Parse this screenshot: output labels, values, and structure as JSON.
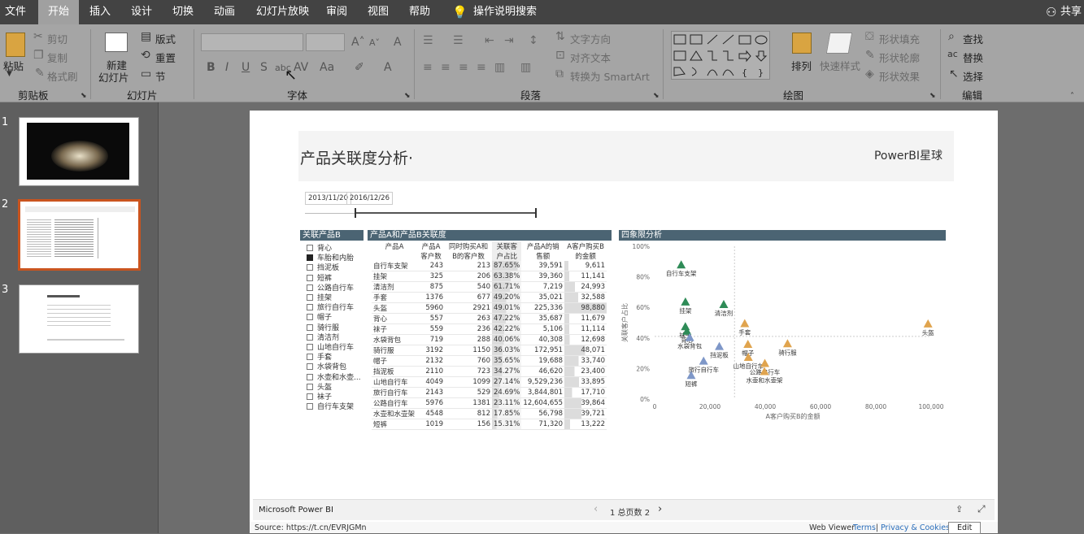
{
  "tabs": [
    "文件",
    "开始",
    "插入",
    "设计",
    "切换",
    "动画",
    "幻灯片放映",
    "审阅",
    "视图",
    "帮助",
    "操作说明搜索"
  ],
  "share_label": "共享",
  "ribbon": {
    "clipboard": {
      "paste": "粘贴",
      "cut": "剪切",
      "copy": "复制",
      "format_painter": "格式刷",
      "group": "剪贴板"
    },
    "slides": {
      "new_slide_1": "新建",
      "new_slide_2": "幻灯片",
      "layout": "版式",
      "reset": "重置",
      "section": "节",
      "group": "幻灯片"
    },
    "font": {
      "group": "字体"
    },
    "paragraph": {
      "text_direction": "文字方向",
      "align_text": "对齐文本",
      "smartart": "转换为 SmartArt",
      "group": "段落"
    },
    "drawing": {
      "arrange": "排列",
      "quick_styles": "快速样式",
      "shape_fill": "形状填充",
      "shape_outline": "形状轮廓",
      "shape_effects": "形状效果",
      "group": "绘图"
    },
    "editing": {
      "find": "查找",
      "replace": "替换",
      "select": "选择",
      "group": "编辑"
    }
  },
  "thumbnails": {
    "numbers": [
      "1",
      "2",
      "3"
    ],
    "selected": 2
  },
  "report": {
    "title": "产品关联度分析·",
    "brand": "PowerBI星球",
    "date_start": "2013/11/20",
    "date_end": "2016/12/26",
    "slicer_title": "关联产品B",
    "slicer_items": [
      {
        "label": "背心",
        "checked": false
      },
      {
        "label": "车胎和内胎",
        "checked": true
      },
      {
        "label": "挡泥板",
        "checked": false
      },
      {
        "label": "短裤",
        "checked": false
      },
      {
        "label": "公路自行车",
        "checked": false
      },
      {
        "label": "挂架",
        "checked": false
      },
      {
        "label": "旅行自行车",
        "checked": false
      },
      {
        "label": "帽子",
        "checked": false
      },
      {
        "label": "骑行服",
        "checked": false
      },
      {
        "label": "清洁剂",
        "checked": false
      },
      {
        "label": "山地自行车",
        "checked": false
      },
      {
        "label": "手套",
        "checked": false
      },
      {
        "label": "水袋背包",
        "checked": false
      },
      {
        "label": "水壶和水壶...",
        "checked": false
      },
      {
        "label": "头盔",
        "checked": false
      },
      {
        "label": "袜子",
        "checked": false
      },
      {
        "label": "自行车支架",
        "checked": false
      }
    ],
    "matrix_title": "产品A和产品B关联度",
    "matrix_headers": [
      [
        "产品A",
        ""
      ],
      [
        "产品A",
        "客户数"
      ],
      [
        "同时购买A和",
        "B的客户数"
      ],
      [
        "关联客",
        "户占比"
      ],
      [
        "产品A的销",
        "售额"
      ],
      [
        "A客户购买B",
        "的金额"
      ]
    ],
    "matrix_rows": [
      [
        "自行车支架",
        "243",
        "213",
        "87.65%",
        "39,591",
        "9,611"
      ],
      [
        "挂架",
        "325",
        "206",
        "63.38%",
        "39,360",
        "11,141"
      ],
      [
        "清洁剂",
        "875",
        "540",
        "61.71%",
        "7,219",
        "24,993"
      ],
      [
        "手套",
        "1376",
        "677",
        "49.20%",
        "35,021",
        "32,588"
      ],
      [
        "头盔",
        "5960",
        "2921",
        "49.01%",
        "225,336",
        "98,880"
      ],
      [
        "背心",
        "557",
        "263",
        "47.22%",
        "35,687",
        "11,679"
      ],
      [
        "袜子",
        "559",
        "236",
        "42.22%",
        "5,106",
        "11,114"
      ],
      [
        "水袋背包",
        "719",
        "288",
        "40.06%",
        "40,308",
        "12,698"
      ],
      [
        "骑行服",
        "3192",
        "1150",
        "36.03%",
        "172,951",
        "48,071"
      ],
      [
        "帽子",
        "2132",
        "760",
        "35.65%",
        "19,688",
        "33,740"
      ],
      [
        "挡泥板",
        "2110",
        "723",
        "34.27%",
        "46,620",
        "23,400"
      ],
      [
        "山地自行车",
        "4049",
        "1099",
        "27.14%",
        "9,529,236",
        "33,895"
      ],
      [
        "旅行自行车",
        "2143",
        "529",
        "24.69%",
        "3,844,801",
        "17,710"
      ],
      [
        "公路自行车",
        "5976",
        "1381",
        "23.11%",
        "12,604,655",
        "39,864"
      ],
      [
        "水壶和水壶架",
        "4548",
        "812",
        "17.85%",
        "56,798",
        "39,721"
      ],
      [
        "短裤",
        "1019",
        "156",
        "15.31%",
        "71,320",
        "13,222"
      ]
    ],
    "scatter_title": "四象限分析",
    "footer_brand": "Microsoft Power BI",
    "page_indicator": "1 总页数 2",
    "source": "Source: https://t.cn/EVRJGMn",
    "web_viewer": "Web Viewer",
    "terms": "Terms",
    "privacy": "Privacy & Cookies",
    "edit": "Edit"
  },
  "chart_data": {
    "type": "scatter",
    "title": "四象限分析",
    "xlabel": "A客户购买B的金额",
    "ylabel": "关联客户占比",
    "xlim": [
      0,
      100000
    ],
    "ylim": [
      0,
      1
    ],
    "x_ticks": [
      "0",
      "20,000",
      "40,000",
      "60,000",
      "80,000",
      "100,000"
    ],
    "y_ticks": [
      "0%",
      "20%",
      "40%",
      "60%",
      "80%",
      "100%"
    ],
    "marker": "triangle",
    "colors": {
      "green": "#2e8b57",
      "gold": "#e0a44e",
      "blue": "#7e97c8"
    },
    "points": [
      {
        "label": "自行车支架",
        "x": 9611,
        "y": 0.8765,
        "color": "green"
      },
      {
        "label": "挂架",
        "x": 11141,
        "y": 0.6338,
        "color": "green"
      },
      {
        "label": "清洁剂",
        "x": 24993,
        "y": 0.6171,
        "color": "green"
      },
      {
        "label": "袜子",
        "x": 11114,
        "y": 0.4722,
        "color": "green"
      },
      {
        "label": "背心",
        "x": 11679,
        "y": 0.4422,
        "color": "green"
      },
      {
        "label": "水袋背包",
        "x": 12698,
        "y": 0.4006,
        "color": "blue"
      },
      {
        "label": "手套",
        "x": 32588,
        "y": 0.492,
        "color": "gold"
      },
      {
        "label": "头盔",
        "x": 98880,
        "y": 0.4901,
        "color": "gold"
      },
      {
        "label": "骑行服",
        "x": 48071,
        "y": 0.3603,
        "color": "gold"
      },
      {
        "label": "帽子",
        "x": 33740,
        "y": 0.3565,
        "color": "gold"
      },
      {
        "label": "挡泥板",
        "x": 23400,
        "y": 0.3427,
        "color": "blue"
      },
      {
        "label": "山地自行车",
        "x": 33895,
        "y": 0.2714,
        "color": "gold"
      },
      {
        "label": "旅行自行车",
        "x": 17710,
        "y": 0.2469,
        "color": "blue"
      },
      {
        "label": "公路自行车",
        "x": 39864,
        "y": 0.2311,
        "color": "gold"
      },
      {
        "label": "水壶和水壶架",
        "x": 39721,
        "y": 0.1785,
        "color": "gold"
      },
      {
        "label": "短裤",
        "x": 13222,
        "y": 0.1531,
        "color": "blue"
      }
    ]
  }
}
